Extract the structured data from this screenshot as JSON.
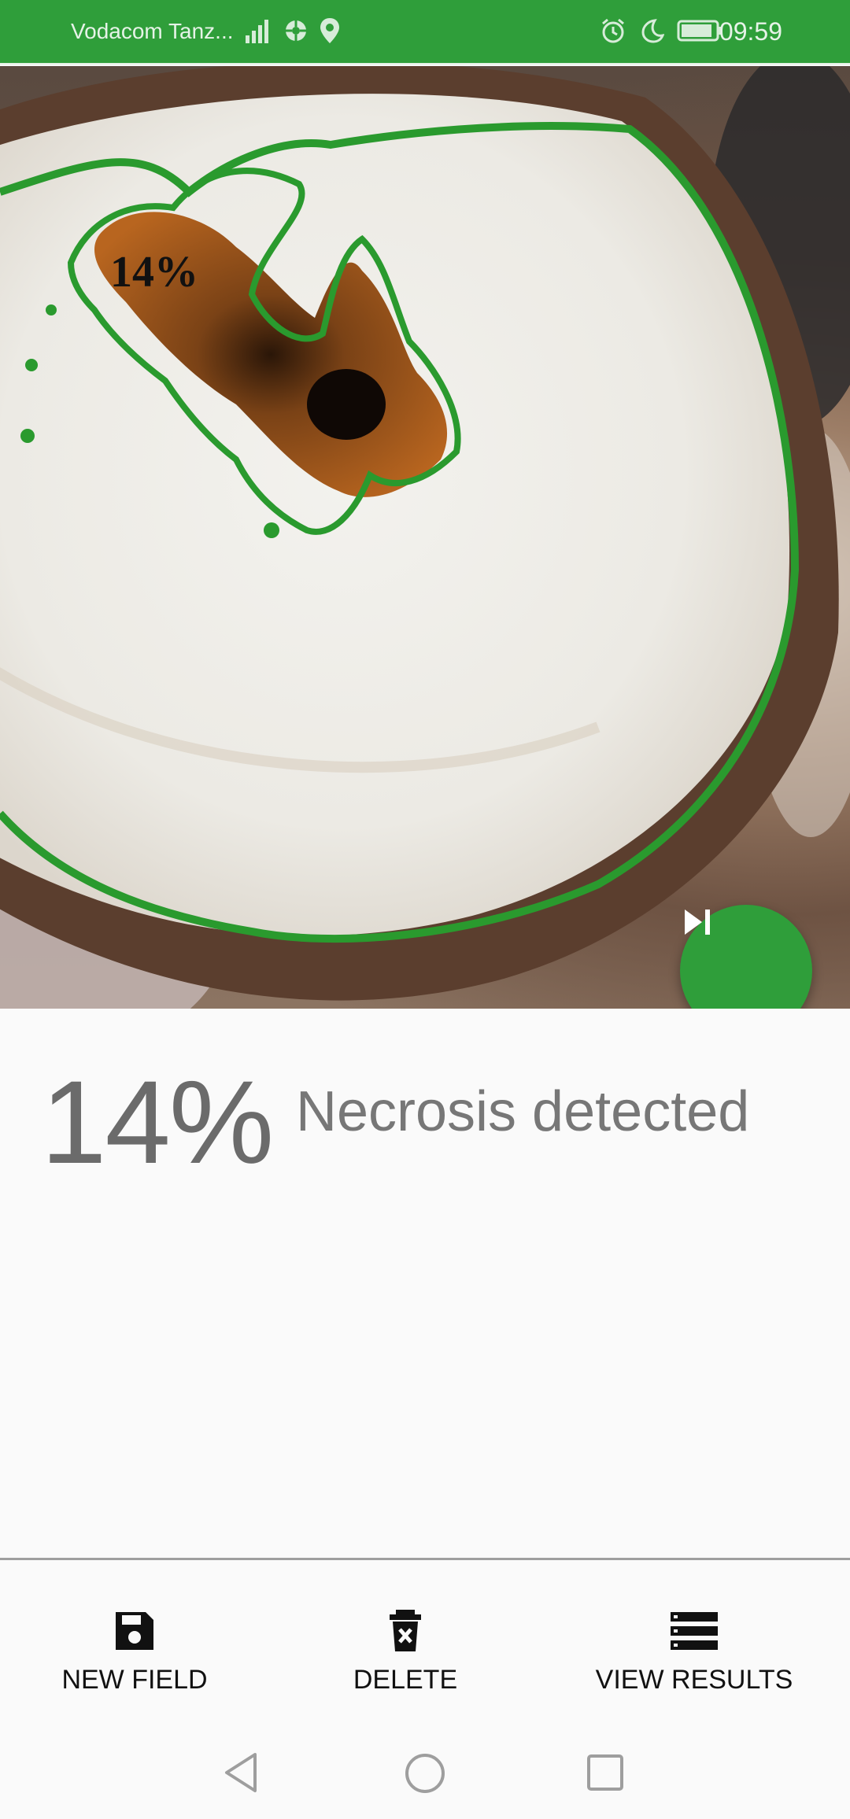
{
  "status_bar": {
    "carrier": "Vodacom Tanz...",
    "time": "09:59",
    "left_icons": [
      "signal-icon",
      "data-icon",
      "location-icon"
    ],
    "right_icons": [
      "alarm-icon",
      "moon-icon",
      "battery-icon"
    ]
  },
  "photo": {
    "overlay_label": "14%",
    "contour_color": "#2a9a2e"
  },
  "fab": {
    "icon": "skip-next-icon",
    "color": "#2f9e3a"
  },
  "result": {
    "percent": "14%",
    "label": "Necrosis detected"
  },
  "bottom_bar": {
    "items": [
      {
        "label": "NEW FIELD",
        "icon": "save-icon"
      },
      {
        "label": "DELETE",
        "icon": "delete-icon"
      },
      {
        "label": "VIEW RESULTS",
        "icon": "list-icon"
      }
    ]
  },
  "nav": {
    "icons": [
      "back-icon",
      "home-icon",
      "recents-icon"
    ]
  }
}
